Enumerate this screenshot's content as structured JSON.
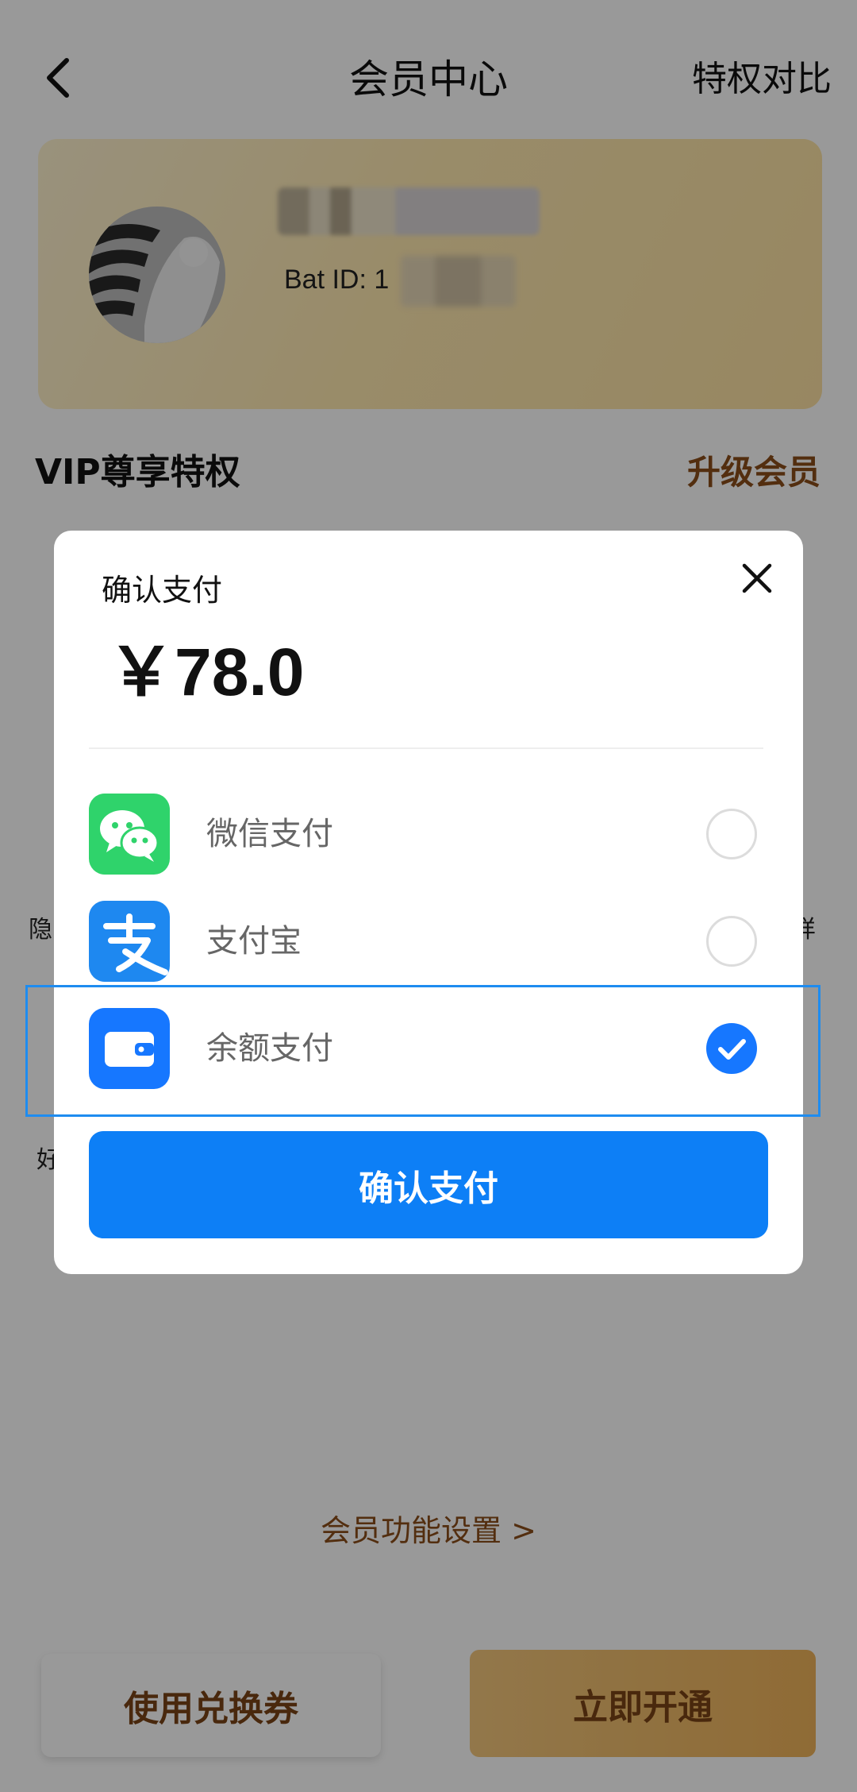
{
  "header": {
    "title": "会员中心",
    "right_link": "特权对比"
  },
  "member_card": {
    "id_prefix": "Bat ID: 1"
  },
  "section": {
    "title": "VIP尊享特权",
    "upgrade_link": "升级会员"
  },
  "background_fragments": {
    "left_1": "隐",
    "right_1": "详",
    "left_2": "好"
  },
  "settings_link": "会员功能设置 >",
  "bottom_bar": {
    "coupon_button": "使用兑换券",
    "open_button": "立即开通"
  },
  "payment_dialog": {
    "title": "确认支付",
    "amount": "￥78.0",
    "methods": [
      {
        "label": "微信支付",
        "icon": "wechat-pay-icon",
        "selected": false
      },
      {
        "label": "支付宝",
        "icon": "alipay-icon",
        "selected": false
      },
      {
        "label": "余额支付",
        "icon": "wallet-icon",
        "selected": true
      }
    ],
    "confirm_button": "确认支付"
  },
  "colors": {
    "accent_blue": "#0d7ff6",
    "brown_text": "#8a4d1a",
    "wechat_green": "#2fd36b",
    "alipay_blue": "#1e88f0"
  }
}
